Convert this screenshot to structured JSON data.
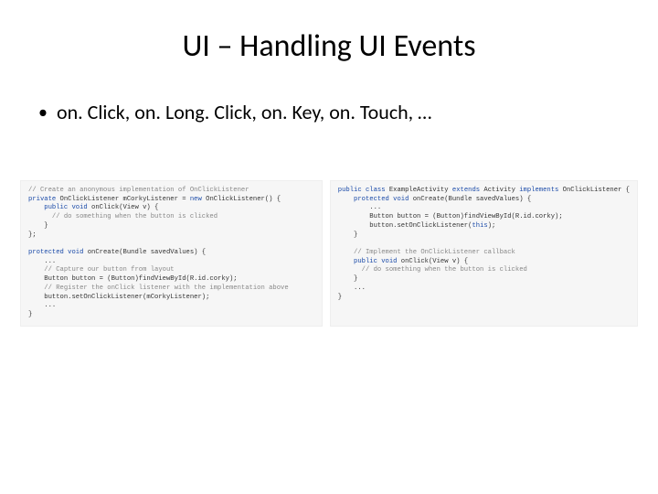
{
  "title": "UI – Handling UI Events",
  "bullet": "on. Click, on. Long. Click, on. Key, on. Touch, …",
  "code_left": {
    "l1a": "// Create an anonymous implementation of OnClickListener",
    "l2a": "private",
    "l2b": " OnClickListener mCorkyListener = ",
    "l2c": "new",
    "l2d": " OnClickListener() {",
    "l3a": "    public void",
    "l3b": " onClick(View v) {",
    "l4a": "      // do something when the button is clicked",
    "l5a": "    }",
    "l6a": "};",
    "l7a": " ",
    "l8a": "protected void",
    "l8b": " onCreate(Bundle savedValues) {",
    "l9a": "    ...",
    "l10a": "    // Capture our button from layout",
    "l11a": "    Button button = (Button)findViewById(R.id.corky);",
    "l12a": "    // Register the onClick listener with the implementation above",
    "l13a": "    button.setOnClickListener(mCorkyListener);",
    "l14a": "    ...",
    "l15a": "}"
  },
  "code_right": {
    "r1a": "public class",
    "r1b": " ExampleActivity ",
    "r1c": "extends",
    "r1d": " Activity ",
    "r1e": "implements",
    "r1f": " OnClickListener {",
    "r2a": "    protected void",
    "r2b": " onCreate(Bundle savedValues) {",
    "r3a": "        ...",
    "r4a": "        Button button = (Button)findViewById(R.id.corky);",
    "r5a": "        button.setOnClickListener(",
    "r5b": "this",
    "r5c": ");",
    "r6a": "    }",
    "r7a": " ",
    "r8a": "    // Implement the OnClickListener callback",
    "r9a": "    public void",
    "r9b": " onClick(View v) {",
    "r10a": "      // do something when the button is clicked",
    "r11a": "    }",
    "r12a": "    ...",
    "r13a": "}"
  }
}
